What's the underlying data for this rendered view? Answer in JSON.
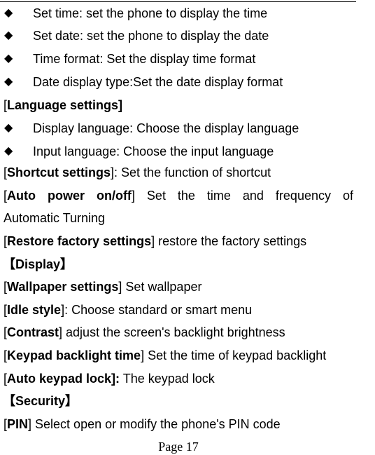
{
  "time_date_bullets": [
    "Set time: set the phone to display the time",
    "Set date: set the phone to display the date",
    "Time format: Set the display time format",
    "Date display type:Set the date display format"
  ],
  "language": {
    "open": "[",
    "title": "Language settings]",
    "bullets": [
      "Display language: Choose the display language",
      "Input language: Choose the input language"
    ]
  },
  "shortcut": {
    "open": "[",
    "title": "Shortcut settings",
    "rest": "]: Set the function of shortcut"
  },
  "auto_power": {
    "words": [
      "Auto",
      "power",
      "on/off",
      "Set",
      "the",
      "time",
      "and",
      "frequency",
      "of"
    ],
    "open": "[",
    "close": "]",
    "continuation": "Automatic Turning"
  },
  "restore": {
    "open": "[",
    "title": "Restore factory settings",
    "rest": "] restore the factory settings"
  },
  "display_section": {
    "title": "【Display】"
  },
  "wallpaper": {
    "open": "[",
    "title": "Wallpaper settings",
    "rest": "] Set wallpaper"
  },
  "idle": {
    "open": "[",
    "title": "Idle style",
    "rest": "]: Choose standard or smart menu"
  },
  "contrast": {
    "open": "[",
    "title": "Contrast",
    "rest": "] adjust the screen's backlight brightness"
  },
  "keypad_backlight": {
    "open": "[",
    "title": "Keypad backlight time",
    "rest": "] Set the time of keypad backlight"
  },
  "auto_keypad": {
    "open": "[",
    "title": "Auto keypad lock]:",
    "rest": " The keypad lock"
  },
  "security_section": {
    "title": "【Security】"
  },
  "pin": {
    "open": "[",
    "title": "PIN",
    "rest": "] Select open or modify the phone's PIN code"
  },
  "footer": {
    "page_label": "Page 17"
  },
  "icons": {
    "bullet": "◆"
  }
}
